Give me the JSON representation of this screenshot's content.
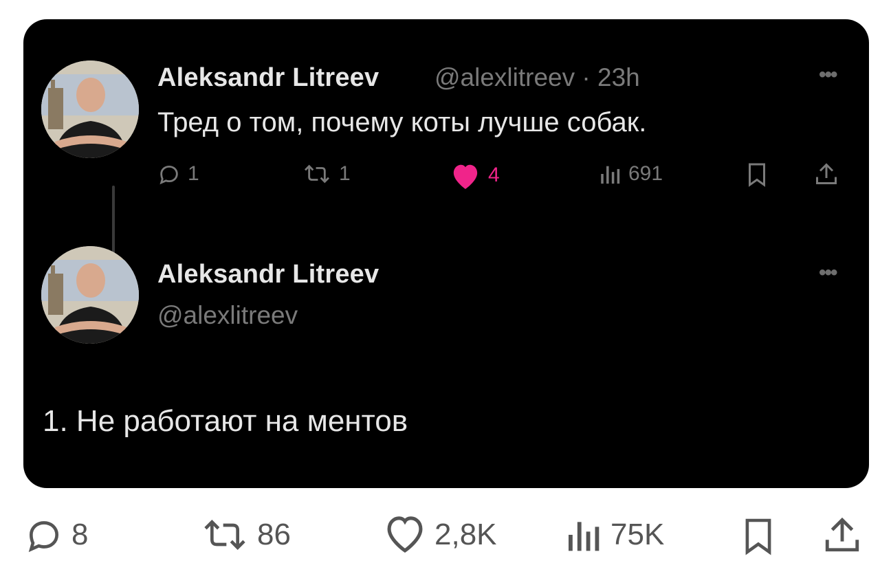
{
  "tweet1": {
    "display_name": "Aleksandr Litreev",
    "handle_time": "@alexlitreev · 23h",
    "text": "Тред о том, почему коты лучше собак.",
    "stats": {
      "replies": "1",
      "retweets": "1",
      "likes": "4",
      "views": "691"
    }
  },
  "tweet2": {
    "display_name": "Aleksandr Litreev",
    "handle": "@alexlitreev",
    "text": "1. Не работают на ментов"
  },
  "outer_stats": {
    "replies": "8",
    "retweets": "86",
    "likes": "2,8K",
    "views": "75K"
  },
  "colors": {
    "card_background": "#000000",
    "like_active": "#f0248a",
    "muted_text": "#7a7a7a"
  },
  "icons": [
    "reply-icon",
    "retweet-icon",
    "heart-icon",
    "views-icon",
    "bookmark-icon",
    "share-icon",
    "more-icon"
  ]
}
